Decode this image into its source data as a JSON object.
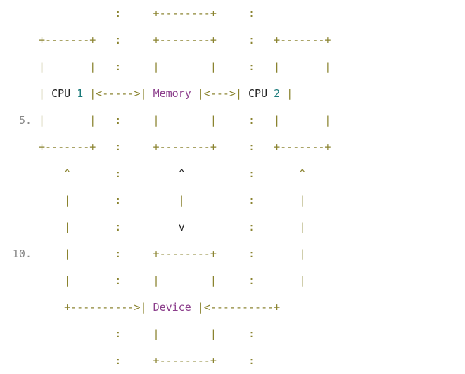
{
  "gutter": {
    "line5": "5.",
    "line10": "10."
  },
  "labels": {
    "cpu": "CPU",
    "one": "1",
    "two": "2",
    "memory": "Memory",
    "device": "Device"
  },
  "ascii": {
    "row1": "            :     +--------+     :\n",
    "row2a": "+-------+   :     +--------+     :   +-------+\n",
    "row3": "|       |   :     |        |     :   |       |\n",
    "row4a": "| ",
    "row4b": " |<----->| ",
    "row4c": " |<--->| ",
    "row4d": " |\n",
    "row5": "|       |   :     |        |     :   |       |\n",
    "row6": "+-------+   :     +--------+     :   +-------+\n",
    "row7": "    ^       :         ^          :       ^\n",
    "row8": "    |       :         |          :       |\n",
    "row9": "    |       :         v          :       |\n",
    "row10": "    |       :     +--------+     :       |\n",
    "row11": "    |       :     |        |     :       |\n",
    "row12a": "    +---------->| ",
    "row12b": " |<----------+\n",
    "row13": "            :     |        |     :\n",
    "row14": "            :     +--------+     :\n"
  }
}
